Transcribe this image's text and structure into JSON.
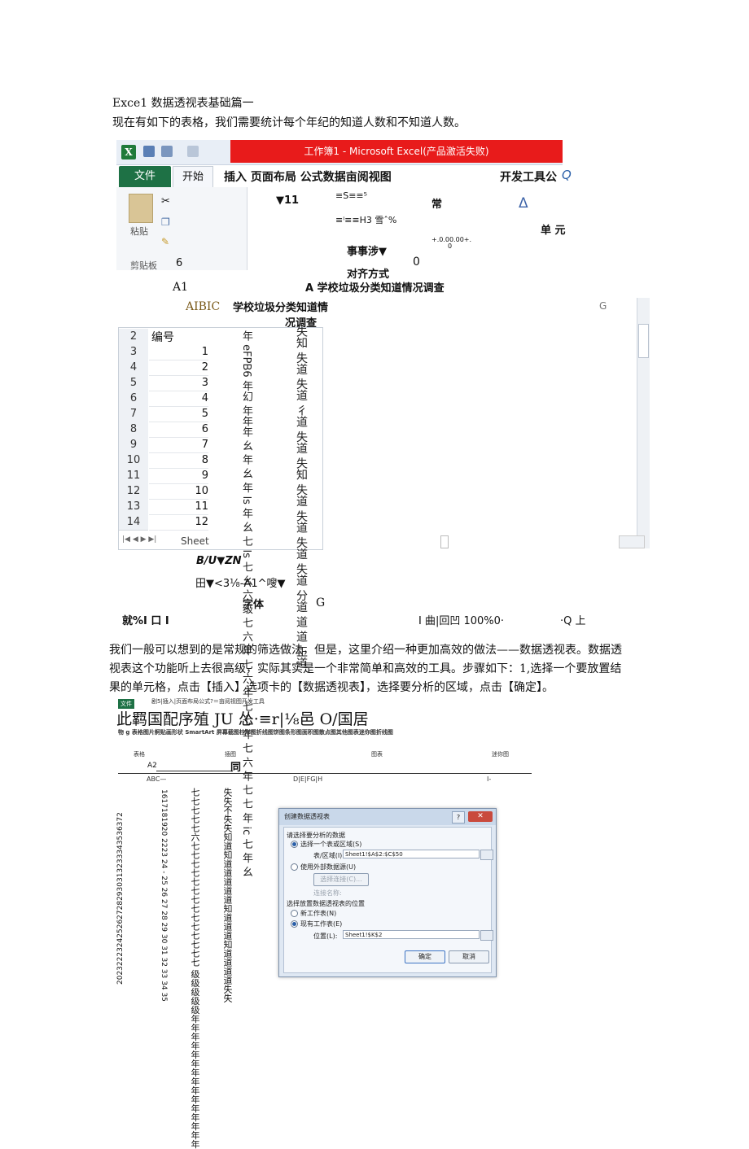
{
  "doc": {
    "title": "Exce1 数据透视表基础篇一",
    "intro": "现在有如下的表格，我们需要统计每个年纪的知道人数和不知道人数。",
    "para1": "我们一般可以想到的是常规的筛选做法，但是，这里介绍一种更加高效的做法——数据透视表。数据透",
    "para2": "视表这个功能听上去很高级，实际其实是一个非常简单和高效的工具。步骤如下：1,选择一个要放置结",
    "para3": "果的单元格，点击【插入】选项卡的【数据透视表】，选择要分析的区域，点击【确定】。"
  },
  "excel1": {
    "app_icon": "X",
    "title": "工作簿1 - Microsoft Excel(产品激活失败)",
    "tab_file": "文件",
    "tab_home": "开始",
    "tab_rest": "插入 页面布局 公式数据亩阅视图",
    "tab_dev": "开发工具公",
    "tab_end": "Q",
    "paste_label": "粘贴",
    "clipboard_label": "剪贴板",
    "r_6": "6",
    "r_font_size": "▼11",
    "r_align1": "≡S≡≡⁵",
    "r_align2": "≡ⁱ≡≡H3 雪ˆ%",
    "r_chang": "常",
    "r_delta": "Δ",
    "r_danyuan": "单 元",
    "r_shishi": "事事涉▼",
    "r_decimals": "+.0.00.00+.",
    "r_zero_small": "0",
    "r_zero": "0",
    "r_align_label": "对齐方式",
    "name_box": "A1",
    "formula": "A 学校垃圾分类知道情况调查",
    "sheet_title_a": "AIBIC",
    "sheet_title_b": "学校垃圾分类知道情",
    "sheet_title_c": "况调查",
    "col_g": "G",
    "hdr_num": "编号",
    "rows": [
      "2",
      "3",
      "4",
      "5",
      "6",
      "7",
      "8",
      "9",
      "10",
      "11",
      "12",
      "13",
      "14"
    ],
    "nums": [
      "1",
      "2",
      "3",
      "4",
      "5",
      "6",
      "7",
      "8",
      "9",
      "10",
      "11",
      "12"
    ],
    "col_b_text": "年 eFPB6 年幻 年年年 幺 年 幺 年 ls 年 幺 七 ls 七 幺 六 级 七 六 年 七 六 年 七 七 年 七 六 年 七 七 年 ic 七 年 幺",
    "col_c_text": "失知 失道 失道 彳道 失道 失知 失道 失道 失道 失道 分道 道 道 正道",
    "sheet_tab": "Sheet",
    "font_b": "B/U▼ZN",
    "font_border": "田▼<3⅛-A1^嗖▼",
    "font_label": "字体",
    "font_g": "G",
    "status_left": "就%I 口 I",
    "status_mid": "I 曲|回凹 100%0·",
    "status_right": "·Q 上"
  },
  "excel2": {
    "file_tab": "文件",
    "tabs_small": "剧5|插入|页面布局公式?＝亩阅视图开发工具",
    "big_line": "此羁国配序殖 JU 怂·≡r|⅛邑 O/国居",
    "icon_line": "物 g 表格图片舸贴画形状 SmartArt 屏幕截图柱形图折线图饼图条形图面积图散点图其他图表迷你图折线图",
    "group_table": "表格",
    "group_illus": "插图",
    "group_chart": "图表",
    "group_spark": "迷你图",
    "cell_ref": "A2",
    "cell_tong": "同",
    "cols_left": "ABC—",
    "cols_mid": "D|E|FG|H",
    "cols_right": "I-",
    "rownums": "1617181920 2223 24 - 25 26 27 28 29 30 31 32 33 34 35",
    "rownums2": "2023222324252627282930313233343536372",
    "col_b2": "七七七七七六七七七七七七七七七七七七七七 级级级级级年年年年年年年年年年年年年年年",
    "col_c2": "失失不失失知道知道道道道道知道道道知道道道道失失"
  },
  "dialog": {
    "title": "创建数据透视表",
    "help": "?",
    "close": "✕",
    "sec1": "请选择要分析的数据",
    "opt1": "选择一个表或区域(S)",
    "range_label": "表/区域(I):",
    "range_value": "Sheet1!$A$2:$C$50",
    "opt2": "使用外部数据源(U)",
    "choose_conn": "选择连接(C)...",
    "conn_name": "连接名称:",
    "sec2": "选择放置数据透视表的位置",
    "opt3": "新工作表(N)",
    "opt4": "现有工作表(E)",
    "loc_label": "位置(L):",
    "loc_value": "Sheet1!$K$2",
    "ok": "确定",
    "cancel": "取消"
  }
}
